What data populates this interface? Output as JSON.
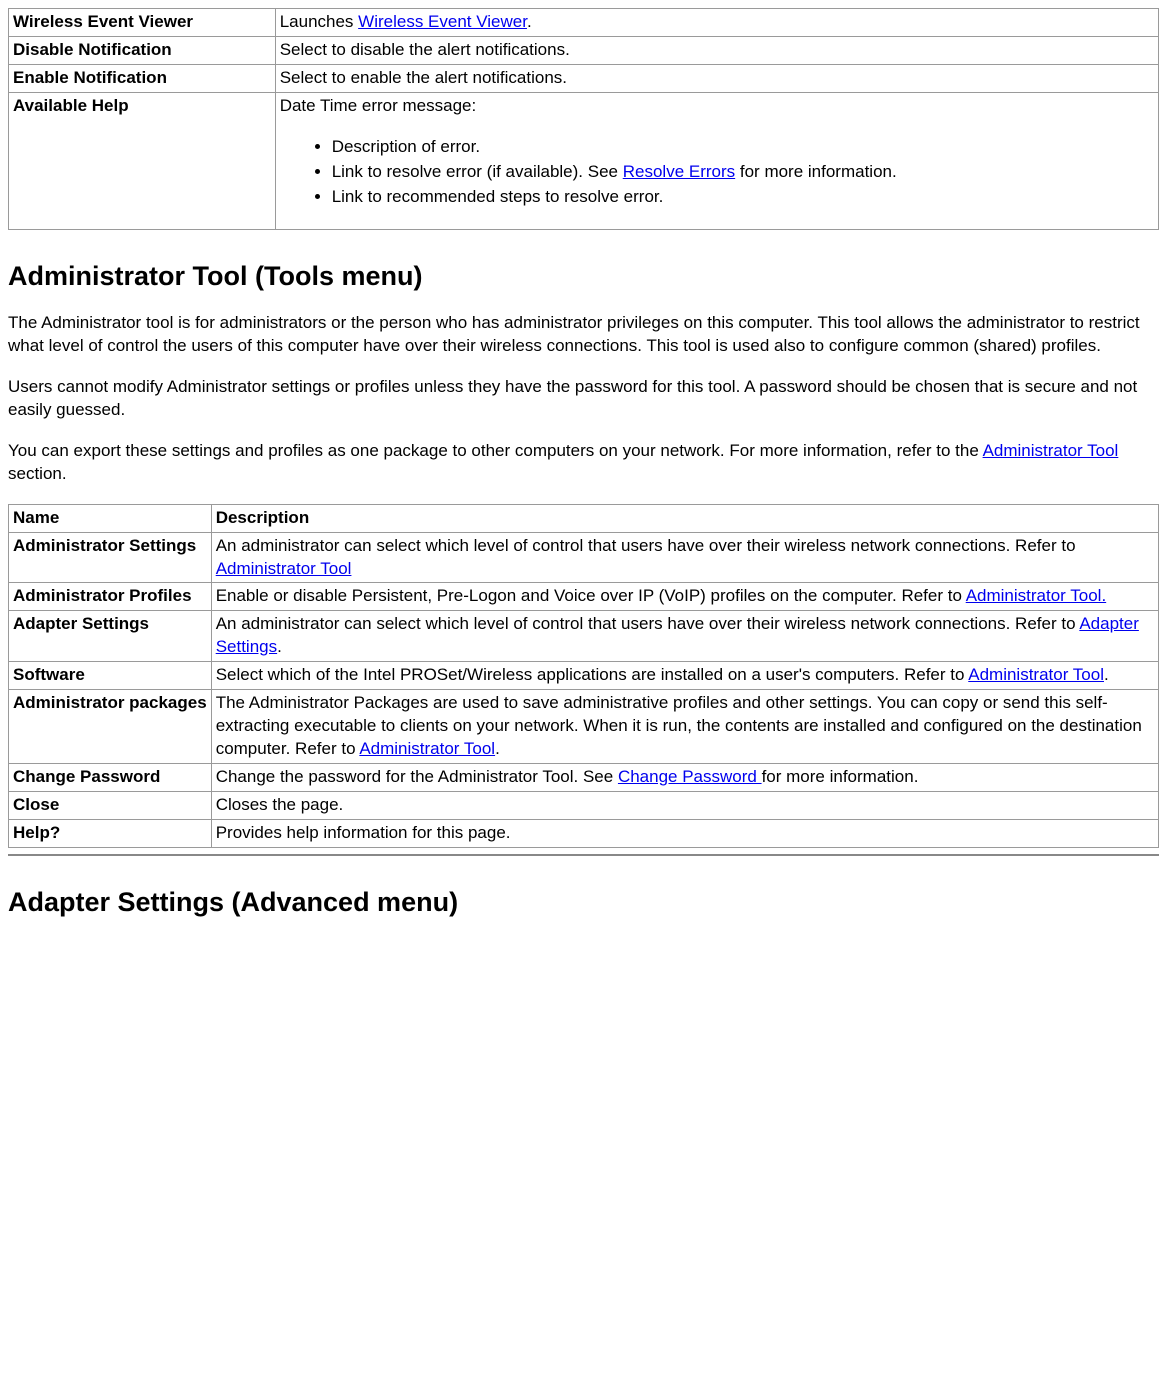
{
  "table1": {
    "rows": [
      {
        "name": "Wireless Event Viewer",
        "pre": "Launches ",
        "link": "Wireless Event Viewer",
        "post": "."
      },
      {
        "name": "Disable Notification",
        "desc": "Select to disable the alert notifications."
      },
      {
        "name": "Enable Notification",
        "desc": "Select to enable the alert notifications."
      }
    ],
    "help": {
      "name": "Available Help",
      "intro": "Date Time error message:",
      "bullet1": "Description of error.",
      "bullet2_pre": "Link to resolve error (if available). See ",
      "bullet2_link": "Resolve Errors",
      "bullet2_post": " for more information.",
      "bullet3": "Link to recommended steps to resolve error."
    }
  },
  "h2_admin": "Administrator Tool (Tools menu)",
  "p1": "The Administrator tool is for administrators or the person who has administrator privileges on this computer. This tool allows the administrator to restrict what level of control the users of this computer have over their wireless connections. This tool is used also to configure common (shared) profiles.",
  "p2": "Users cannot modify Administrator settings or profiles unless they have the password for this tool. A password should be chosen that is secure and not easily guessed.",
  "p3_pre": "You can export these settings and profiles as one package to other computers on your network. For more information, refer to the ",
  "p3_link": "Administrator Tool",
  "p3_post": " section.",
  "table2": {
    "header": {
      "name": "Name",
      "desc": "Description"
    },
    "r1": {
      "name": "Administrator Settings",
      "pre": "An administrator can select which level of control that users have over their wireless network connections. Refer to ",
      "link": "Administrator Tool "
    },
    "r2": {
      "name": "Administrator Profiles",
      "pre": "Enable or disable Persistent, Pre-Logon and Voice over IP (VoIP) profiles on the computer. Refer to ",
      "link": "Administrator Tool. "
    },
    "r3": {
      "name": "Adapter Settings",
      "pre": "An administrator can select which level of control that users have over their wireless network connections. Refer to ",
      "link": "Adapter Settings",
      "post": "."
    },
    "r4": {
      "name": "Software",
      "pre": "Select which of the Intel PROSet/Wireless applications are installed on a user's computers. Refer to ",
      "link": "Administrator Tool",
      "post": "."
    },
    "r5": {
      "name": "Administrator packages",
      "pre": "The Administrator Packages are used to save administrative profiles and other settings. You can copy or send this self-extracting executable to clients on your network. When it is run, the contents are installed and configured on the destination computer. Refer to ",
      "link": "Administrator Tool",
      "post": "."
    },
    "r6": {
      "name": "Change Password",
      "pre": "Change the password for the Administrator Tool. See ",
      "link": "Change Password ",
      "post": "for more information."
    },
    "r7": {
      "name": "Close",
      "desc": "Closes the page."
    },
    "r8": {
      "name": "Help?",
      "desc": "Provides help information for this page."
    }
  },
  "h2_adapter": "Adapter Settings (Advanced menu)"
}
